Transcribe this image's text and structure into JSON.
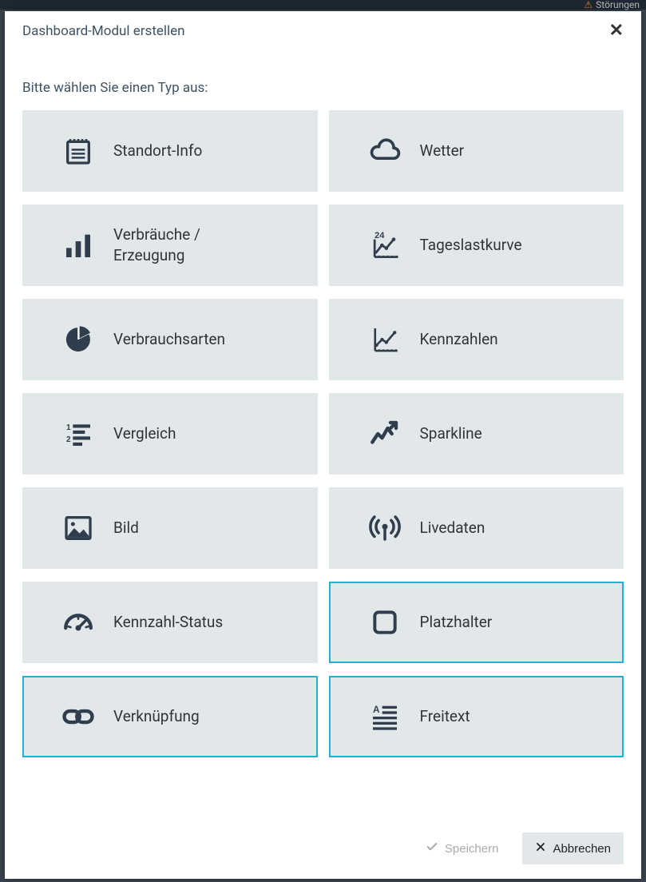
{
  "backdrop": {
    "top_label": "Störungen"
  },
  "modal": {
    "title": "Dashboard-Modul erstellen",
    "subtitle": "Bitte wählen Sie einen Typ aus:"
  },
  "tiles": [
    {
      "id": "standort-info",
      "label": "Standort-Info",
      "icon": "notepad",
      "selected": false
    },
    {
      "id": "wetter",
      "label": "Wetter",
      "icon": "cloud",
      "selected": false
    },
    {
      "id": "verbraeuche",
      "label": "Verbräuche / Erzeugung",
      "icon": "barchart",
      "selected": false
    },
    {
      "id": "tageslast",
      "label": "Tageslastkurve",
      "icon": "chart24",
      "selected": false
    },
    {
      "id": "verbrauchsarten",
      "label": "Verbrauchsarten",
      "icon": "pie",
      "selected": false
    },
    {
      "id": "kennzahlen",
      "label": "Kennzahlen",
      "icon": "linechart",
      "selected": false
    },
    {
      "id": "vergleich",
      "label": "Vergleich",
      "icon": "compare",
      "selected": false
    },
    {
      "id": "sparkline",
      "label": "Sparkline",
      "icon": "sparkline",
      "selected": false
    },
    {
      "id": "bild",
      "label": "Bild",
      "icon": "image",
      "selected": false
    },
    {
      "id": "livedaten",
      "label": "Livedaten",
      "icon": "broadcast",
      "selected": false
    },
    {
      "id": "kennzahl-status",
      "label": "Kennzahl-Status",
      "icon": "gauge",
      "selected": false
    },
    {
      "id": "platzhalter",
      "label": "Platzhalter",
      "icon": "square",
      "selected": true
    },
    {
      "id": "verknuepfung",
      "label": "Verknüpfung",
      "icon": "link",
      "selected": true
    },
    {
      "id": "freitext",
      "label": "Freitext",
      "icon": "text",
      "selected": true
    }
  ],
  "footer": {
    "save_label": "Speichern",
    "cancel_label": "Abbrechen"
  }
}
